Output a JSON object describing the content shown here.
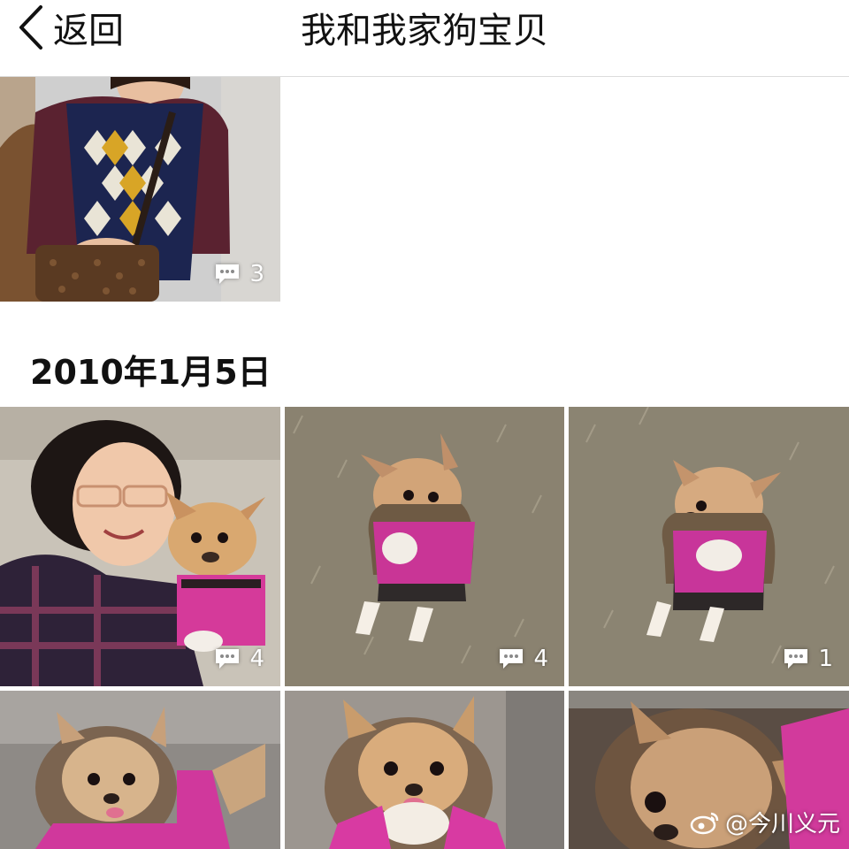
{
  "nav": {
    "back_label": "返回",
    "title": "我和我家狗宝贝"
  },
  "top_photo": {
    "comments": "3"
  },
  "section": {
    "date": "2010年1月5日"
  },
  "grid_row1": [
    {
      "comments": "4"
    },
    {
      "comments": "4"
    },
    {
      "comments": "1"
    }
  ],
  "watermark": {
    "text": "@今川义元"
  },
  "icons": {
    "back": "chevron-left-icon",
    "comment": "speech-bubble-icon",
    "weibo": "weibo-logo-icon"
  }
}
